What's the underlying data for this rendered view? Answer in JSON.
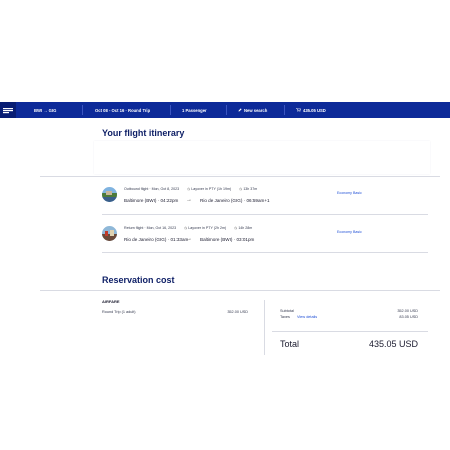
{
  "header": {
    "route": "BWI → GIG",
    "dates": "Oct 08 - Oct 16 · Round Trip",
    "passengers": "1 Passenger",
    "new_search": "New search",
    "cart_total": "435.05 USD"
  },
  "itinerary": {
    "title": "Your flight itinerary",
    "flights": [
      {
        "label": "Outbound flight · Mon, Oct 8, 2023",
        "layover": "Layover in PTY (1h 19m)",
        "duration": "13h 37m",
        "from": "Baltimore (BWI) · 04:22pm",
        "to": "Rio de Janeiro (GIG) · 06:59am+1",
        "cabin": "Economy Basic"
      },
      {
        "label": "Return flight · Mon, Oct 16, 2023",
        "layover": "Layover in PTY (2h 2m)",
        "duration": "14h 28m",
        "from": "Rio de Janeiro (GIG) · 01:33am",
        "to": "Baltimore (BWI) · 03:01pm",
        "cabin": "Economy Basic"
      }
    ]
  },
  "cost": {
    "title": "Reservation cost",
    "airfare_head": "AIRFARE",
    "airfare_line": "Round Trip (1 adult)",
    "airfare_amount": "352.00 USD",
    "subtotal_label": "Subtotal",
    "subtotal_amount": "352.00 USD",
    "taxes_label": "Taxes",
    "taxes_link": "View details",
    "taxes_amount": "83.05 USD",
    "total_label": "Total",
    "total_amount": "435.05 USD"
  },
  "colors": {
    "brand_blue": "#0d2a99",
    "link_blue": "#1f4fd6",
    "heading_navy": "#0e1f66"
  }
}
